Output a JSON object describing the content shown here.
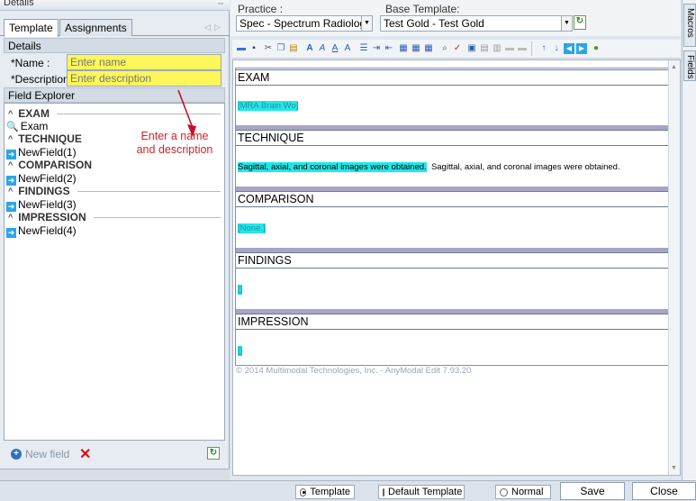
{
  "left_panel": {
    "header_title": "Details",
    "tabs": [
      {
        "label": "Template"
      },
      {
        "label": "Assignments"
      }
    ],
    "details_header": "Details",
    "name_label": "*Name :",
    "name_placeholder": "Enter name",
    "description_label": "*Description",
    "description_placeholder": "Enter description",
    "explorer_header": "Field Explorer",
    "tree": {
      "exam_header": "EXAM",
      "exam_item": "Exam",
      "technique_header": "TECHNIQUE",
      "technique_item": "NewField(1)",
      "comparison_header": "COMPARISON",
      "comparison_item": "NewField(2)",
      "findings_header": "FINDINGS",
      "findings_item": "NewField(3)",
      "impression_header": "IMPRESSION",
      "impression_item": "NewField(4)"
    },
    "annotation": "Enter a name and description",
    "new_field_label": "New field"
  },
  "topbar": {
    "practice_label": "Practice :",
    "practice_value": "Spec - Spectrum Radiology",
    "base_template_label": "Base Template:",
    "base_template_value": "Test Gold - Test Gold"
  },
  "side_tabs": [
    "Macros",
    "Fields"
  ],
  "document": {
    "sections": [
      {
        "title": "EXAM",
        "field_text": "[MRA Brain Wo]",
        "plain_text": ""
      },
      {
        "title": "TECHNIQUE",
        "field_text": "Sagittal, axial, and coronal images were obtained.",
        "plain_text": "Sagittal, axial, and coronal images were obtained."
      },
      {
        "title": "COMPARISON",
        "field_text": "[None.]",
        "plain_text": ""
      },
      {
        "title": "FINDINGS",
        "field_text": "[]",
        "plain_text": ""
      },
      {
        "title": "IMPRESSION",
        "field_text": "[]",
        "plain_text": ""
      }
    ],
    "copyright": "© 2014 Multimodal Technologies, Inc. - AnyModal Edit 7.93.20"
  },
  "status_bar": {
    "radios": [
      {
        "label": "Template",
        "selected": true
      },
      {
        "label": "Default Template",
        "selected": false
      },
      {
        "label": "Normal",
        "selected": false
      }
    ],
    "save_label": "Save",
    "close_label": "Close"
  },
  "colors": {
    "highlight_yellow": "#fff65a",
    "field_cyan": "#21e8e8",
    "annotation_red": "#d2232a",
    "section_bar": "#a7a4c6"
  }
}
